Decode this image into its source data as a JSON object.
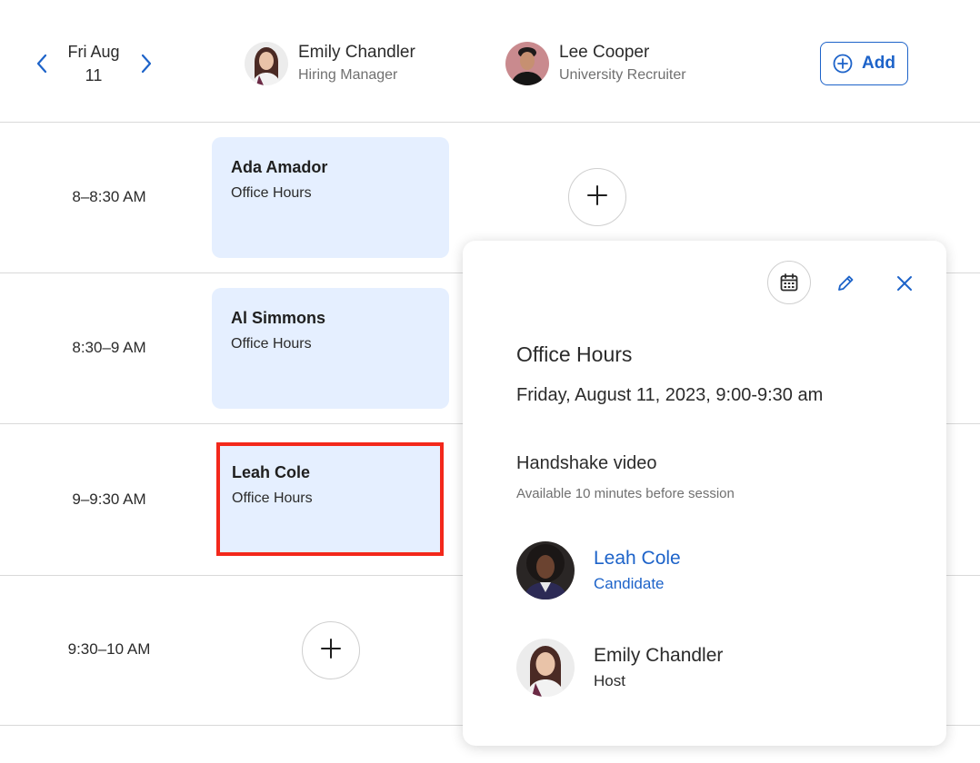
{
  "header": {
    "date_line1": "Fri Aug",
    "date_line2": "11",
    "add_label": "Add",
    "people": [
      {
        "name": "Emily Chandler",
        "role": "Hiring Manager"
      },
      {
        "name": "Lee Cooper",
        "role": "University Recruiter"
      }
    ]
  },
  "slots": [
    {
      "time": "8–8:30 AM"
    },
    {
      "time": "8:30–9 AM"
    },
    {
      "time": "9–9:30 AM"
    },
    {
      "time": "9:30–10 AM"
    }
  ],
  "events": [
    {
      "name": "Ada Amador",
      "type": "Office Hours"
    },
    {
      "name": "Al Simmons",
      "type": "Office Hours"
    },
    {
      "name": "Leah Cole",
      "type": "Office Hours"
    }
  ],
  "popover": {
    "title": "Office Hours",
    "datetime": "Friday, August 11, 2023, 9:00-9:30 am",
    "video_label": "Handshake video",
    "availability": "Available 10 minutes before session",
    "participants": [
      {
        "name": "Leah Cole",
        "role": "Candidate"
      },
      {
        "name": "Emily Chandler",
        "role": "Host"
      }
    ]
  },
  "colors": {
    "accent": "#1d63c9",
    "event_bg": "#e5efff",
    "selection_outline": "#f3281b"
  },
  "icons": [
    "chevron-left-icon",
    "chevron-right-icon",
    "plus-circle-icon",
    "plus-icon",
    "calendar-icon",
    "pencil-icon",
    "close-icon"
  ]
}
